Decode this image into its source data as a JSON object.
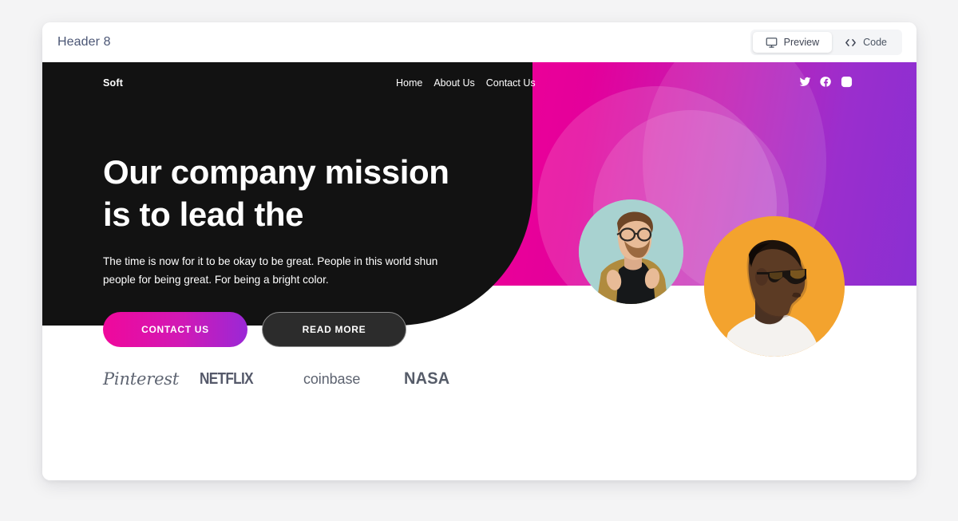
{
  "editor": {
    "title": "Header 8",
    "toggle": {
      "preview_label": "Preview",
      "preview_icon": "monitor-icon",
      "code_label": "Code",
      "code_icon": "code-brackets-icon",
      "active": "Preview"
    }
  },
  "hero": {
    "brand": "Soft",
    "nav": [
      {
        "label": "Home"
      },
      {
        "label": "About Us"
      },
      {
        "label": "Contact Us"
      }
    ],
    "social": [
      {
        "name": "twitter-icon"
      },
      {
        "name": "facebook-icon"
      },
      {
        "name": "instagram-icon"
      }
    ],
    "title_line_1": "Our company mission",
    "title_line_2": "is to lead the",
    "paragraph": "The time is now for it to be okay to be great. People in this world shun people for being great. For being a bright color.",
    "buttons": {
      "primary": "CONTACT US",
      "secondary": "READ MORE"
    },
    "portraits": [
      {
        "name": "portrait-bearded-man-glasses",
        "alt": "Man with glasses and beard on mint background"
      },
      {
        "name": "portrait-man-sunglasses",
        "alt": "Man in profile with sunglasses on orange background"
      }
    ]
  },
  "logos": [
    {
      "name": "pinterest-logo",
      "label": "Pinterest"
    },
    {
      "name": "netflix-logo",
      "label": "NETFLIX"
    },
    {
      "name": "coinbase-logo",
      "label": "coinbase"
    },
    {
      "name": "nasa-logo",
      "label": "NASA"
    }
  ],
  "colors": {
    "page_background": "#f4f4f5",
    "card_background": "#ffffff",
    "hero_background": "#121212",
    "gradient_start": "#ef0097",
    "gradient_end": "#8a2fd2",
    "button_primary_start": "#f0089b",
    "button_primary_end": "#9a28d6",
    "editor_title": "#4b5675",
    "portrait_1_background": "#a9d3d1",
    "portrait_2_background": "#f3a32e"
  }
}
